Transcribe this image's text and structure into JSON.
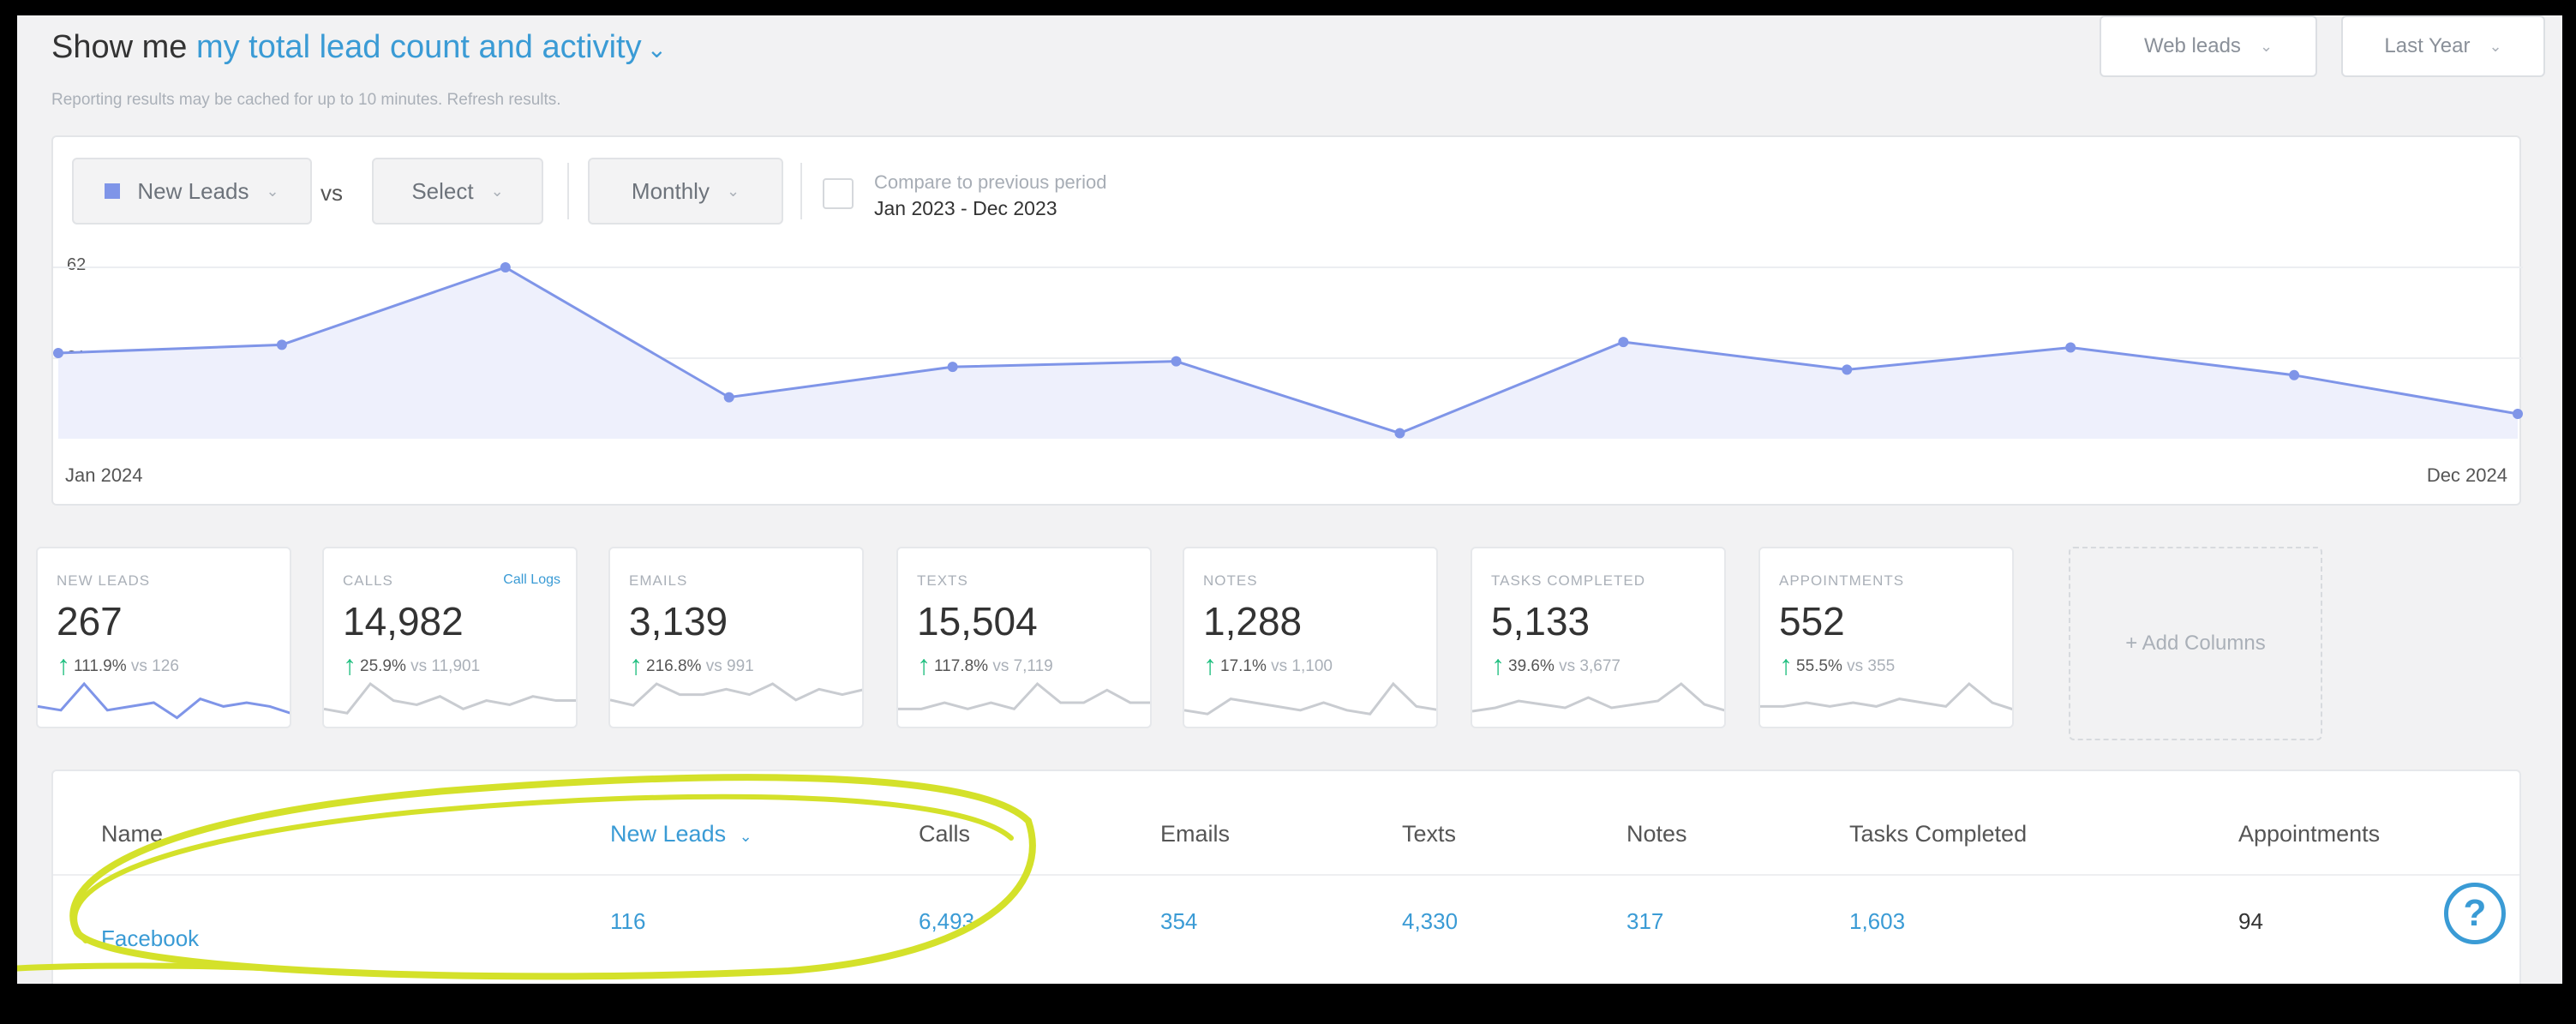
{
  "header": {
    "prefix": "Show me",
    "selector": "my total lead count and activity",
    "chevron": "⌄",
    "cache_note": "Reporting results may be cached for up to 10 minutes.",
    "refresh_link": "Refresh results.",
    "source_filter": "Web leads",
    "period_filter": "Last Year"
  },
  "chart_controls": {
    "metric": "New Leads",
    "vs_label": "vs",
    "compare_metric": "Select",
    "interval": "Monthly",
    "compare_label": "Compare to previous period",
    "compare_range": "Jan 2023 - Dec 2023"
  },
  "chart_data": {
    "type": "area",
    "series": [
      {
        "name": "New Leads",
        "values": [
          31,
          34,
          62,
          15,
          26,
          28,
          2,
          35,
          25,
          33,
          23,
          9
        ]
      }
    ],
    "x_start_label": "Jan 2024",
    "x_end_label": "Dec 2024",
    "y_ticks": [
      "62",
      "31"
    ],
    "ylim": [
      0,
      62
    ],
    "grid": true,
    "color": "#7f95e8"
  },
  "stats": [
    {
      "label": "NEW LEADS",
      "value": "267",
      "change": "111.9%",
      "vs": "vs 126",
      "spark": [
        4,
        3,
        10,
        3,
        4,
        5,
        1,
        6,
        4,
        5,
        4,
        2
      ],
      "color": "#7f95e8"
    },
    {
      "label": "CALLS",
      "extra": "Call Logs",
      "value": "14,982",
      "change": "25.9%",
      "vs": "vs 11,901",
      "spark": [
        3,
        2,
        9,
        5,
        4,
        6,
        3,
        5,
        4,
        6,
        5,
        5
      ],
      "color": "#c9ccd1"
    },
    {
      "label": "EMAILS",
      "value": "3,139",
      "change": "216.8%",
      "vs": "vs 991",
      "spark": [
        4,
        3,
        7,
        5,
        5,
        6,
        5,
        7,
        4,
        6,
        5,
        6
      ],
      "color": "#c9ccd1"
    },
    {
      "label": "TEXTS",
      "value": "15,504",
      "change": "117.8%",
      "vs": "vs 7,119",
      "spark": [
        2,
        2,
        3,
        2,
        3,
        2,
        6,
        3,
        3,
        5,
        3,
        3
      ],
      "color": "#c9ccd1"
    },
    {
      "label": "NOTES",
      "value": "1,288",
      "change": "17.1%",
      "vs": "vs 1,100",
      "spark": [
        3,
        2,
        6,
        5,
        4,
        3,
        5,
        3,
        2,
        10,
        4,
        3
      ],
      "color": "#c9ccd1"
    },
    {
      "label": "TASKS COMPLETED",
      "value": "5,133",
      "change": "39.6%",
      "vs": "vs 3,677",
      "spark": [
        3,
        4,
        6,
        5,
        4,
        7,
        4,
        5,
        6,
        11,
        5,
        3
      ],
      "color": "#c9ccd1"
    },
    {
      "label": "APPOINTMENTS",
      "value": "552",
      "change": "55.5%",
      "vs": "vs 355",
      "spark": [
        4,
        4,
        5,
        4,
        5,
        4,
        6,
        5,
        4,
        10,
        5,
        3
      ],
      "color": "#c9ccd1"
    }
  ],
  "add_columns": "+ Add Columns",
  "table": {
    "headers": [
      "Name",
      "New Leads",
      "Calls",
      "Emails",
      "Texts",
      "Notes",
      "Tasks Completed",
      "Appointments"
    ],
    "sort_indicator": "⌄",
    "rows": [
      [
        "Facebook",
        "116",
        "6,493",
        "354",
        "4,330",
        "317",
        "1,603",
        "94"
      ]
    ]
  },
  "help": "?",
  "annotation_color": "#d4e12a"
}
